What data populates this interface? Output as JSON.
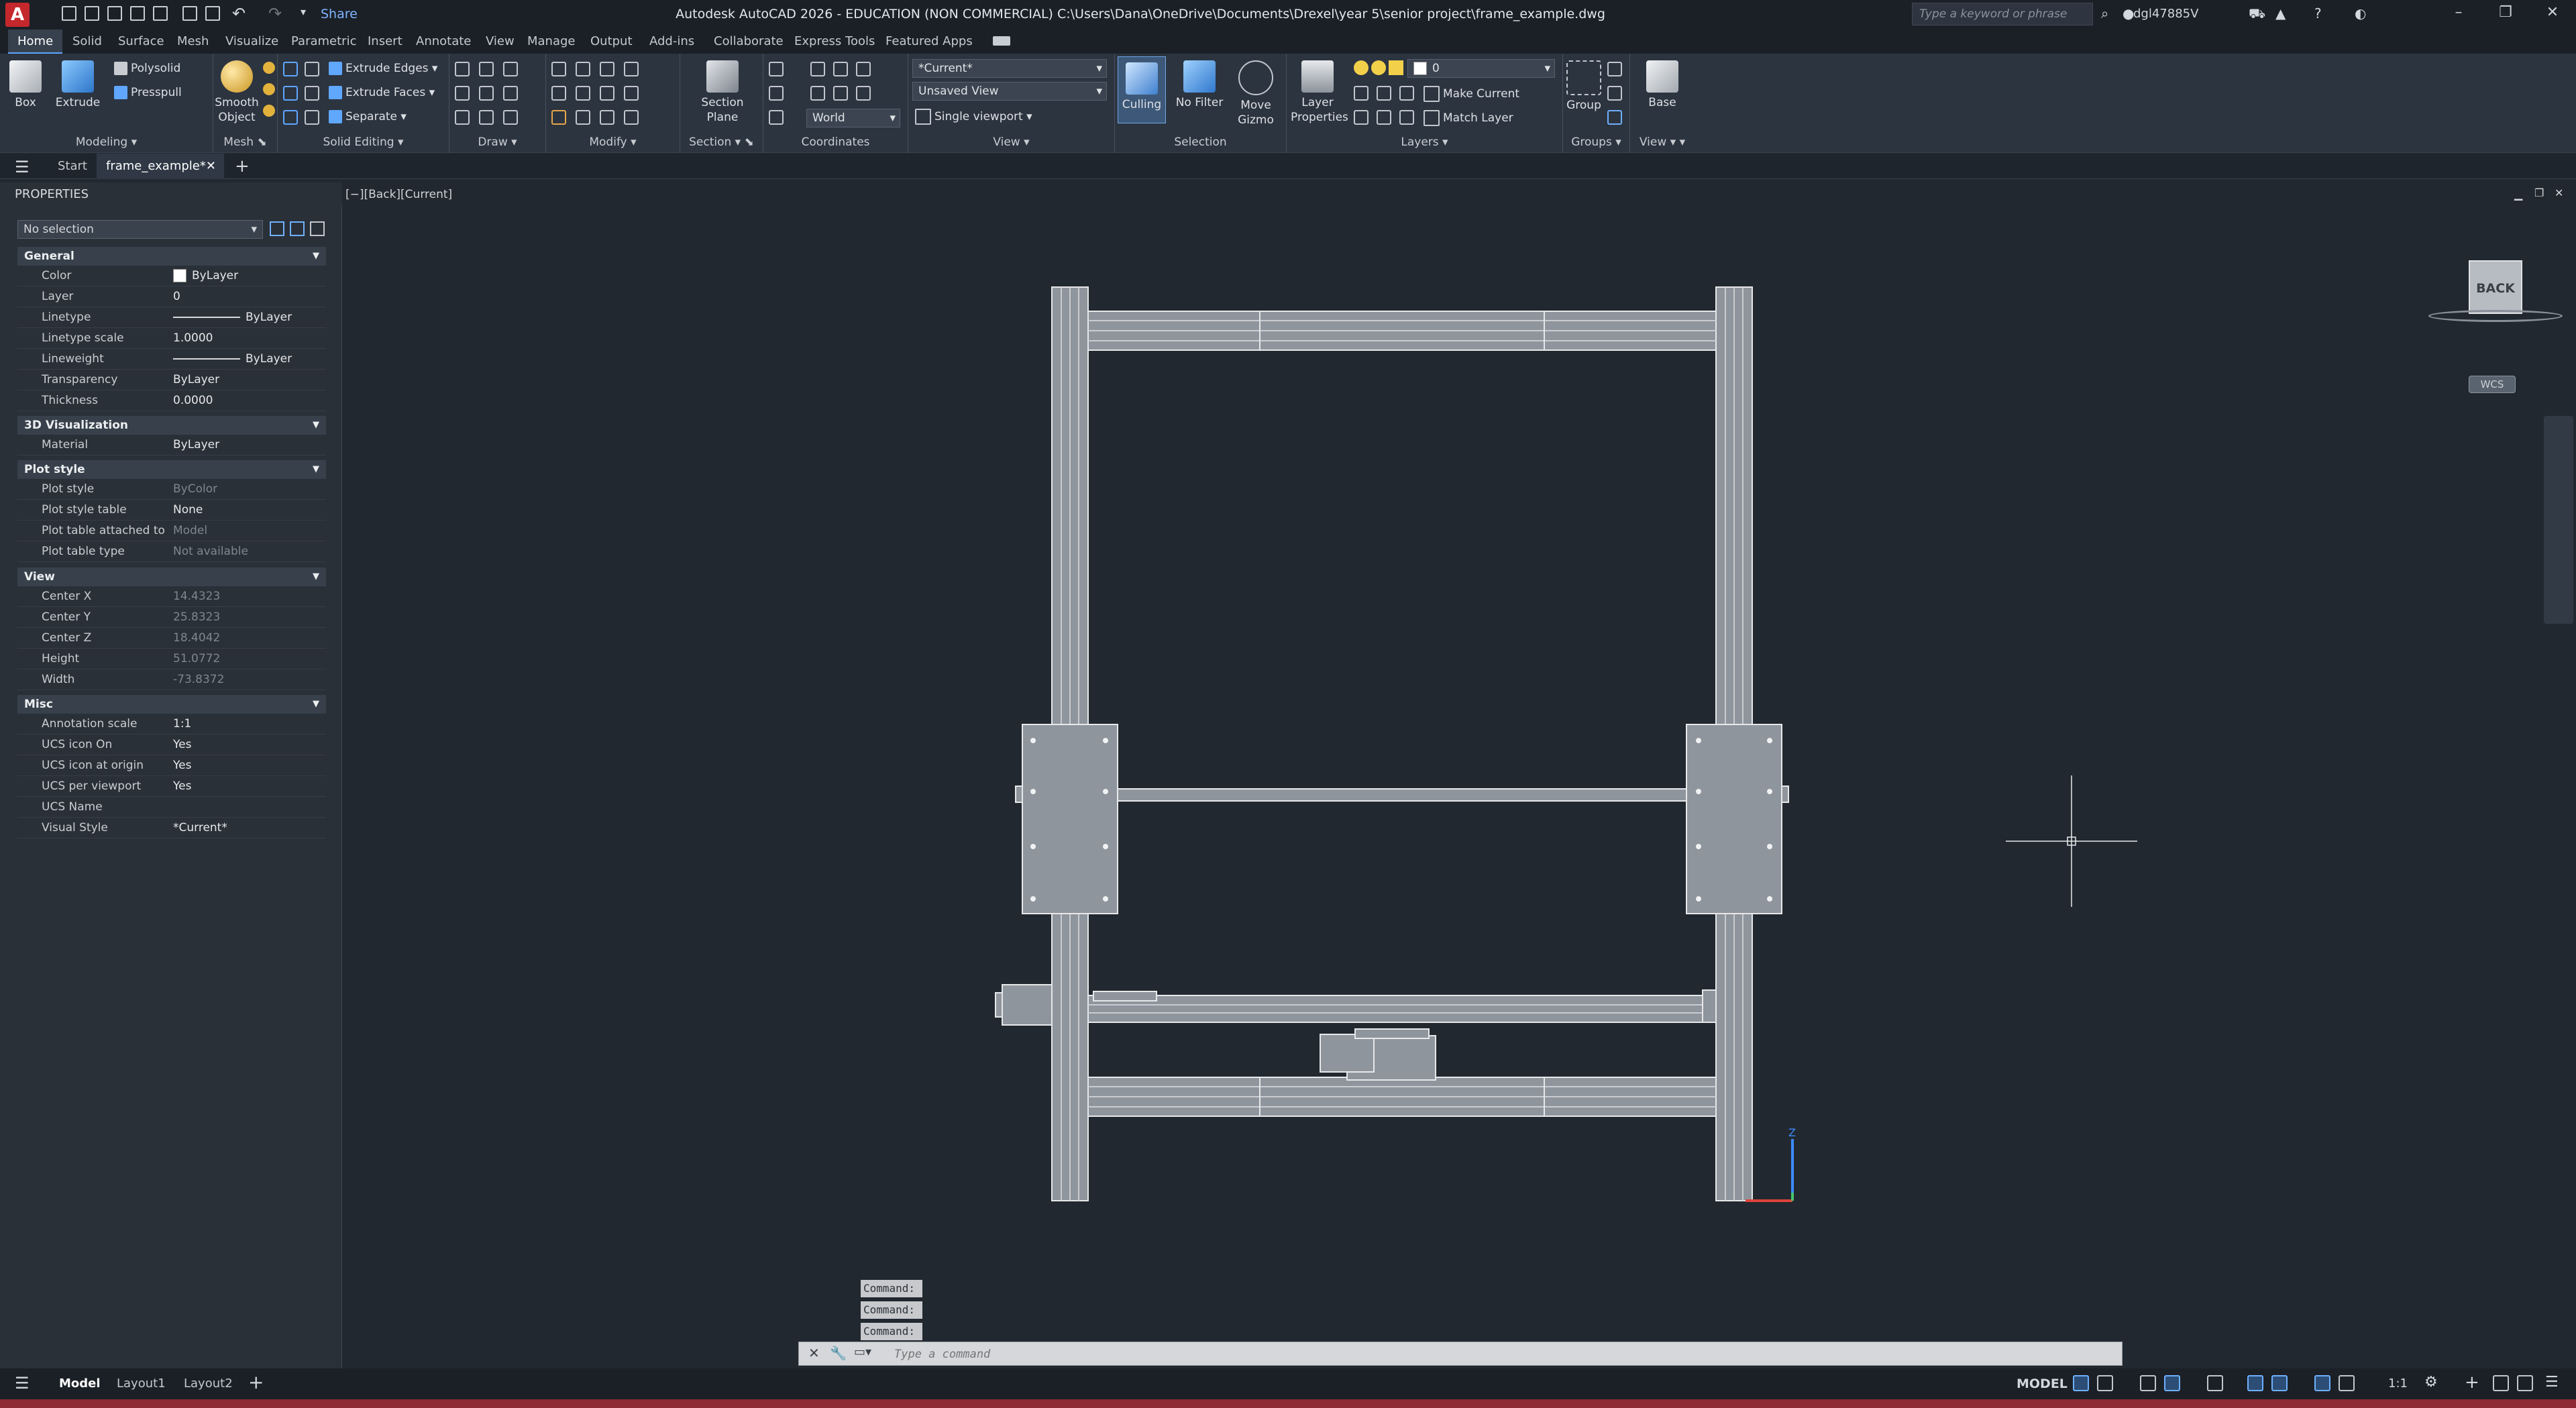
{
  "titlebar": {
    "logo": "A",
    "share": "Share",
    "title": "Autodesk AutoCAD 2026 - EDUCATION (NON COMMERCIAL)    C:\\Users\\Dana\\OneDrive\\Documents\\Drexel\\year 5\\senior project\\frame_example.dwg",
    "search_placeholder": "Type a keyword or phrase",
    "user": "dgl47885V"
  },
  "ribbon_tabs": [
    "Home",
    "Solid",
    "Surface",
    "Mesh",
    "Visualize",
    "Parametric",
    "Insert",
    "Annotate",
    "View",
    "Manage",
    "Output",
    "Add-ins",
    "Collaborate",
    "Express Tools",
    "Featured Apps"
  ],
  "ribbon": {
    "modeling": {
      "title": "Modeling",
      "box": "Box",
      "extrude": "Extrude",
      "polysolid": "Polysolid",
      "presspull": "Presspull"
    },
    "mesh": {
      "title": "Mesh",
      "smooth": "Smooth Object"
    },
    "solid_editing": {
      "title": "Solid Editing",
      "extrude_edges": "Extrude Edges",
      "extrude_faces": "Extrude Faces",
      "separate": "Separate"
    },
    "draw": {
      "title": "Draw"
    },
    "modify": {
      "title": "Modify"
    },
    "section": {
      "title": "Section",
      "plane": "Section Plane"
    },
    "coordinates": {
      "title": "Coordinates",
      "world": "World"
    },
    "view": {
      "title": "View",
      "visual_style": "*Current*",
      "named_view": "Unsaved View",
      "viewport": "Single viewport"
    },
    "selection": {
      "title": "Selection",
      "culling": "Culling",
      "no_filter": "No Filter",
      "move_gizmo": "Move Gizmo"
    },
    "layers": {
      "title": "Layers",
      "layer_props": "Layer Properties",
      "layer_value": "0",
      "make_current": "Make Current",
      "match_layer": "Match Layer"
    },
    "groups": {
      "title": "Groups",
      "group": "Group"
    },
    "view2": {
      "title": "View",
      "base": "Base"
    }
  },
  "file_tabs": {
    "start": "Start",
    "file": "frame_example*"
  },
  "properties": {
    "title": "PROPERTIES",
    "selection": "No selection",
    "sections": [
      {
        "name": "General",
        "rows": [
          {
            "k": "Color",
            "v": "ByLayer"
          },
          {
            "k": "Layer",
            "v": "0"
          },
          {
            "k": "Linetype",
            "v": "ByLayer"
          },
          {
            "k": "Linetype scale",
            "v": "1.0000"
          },
          {
            "k": "Lineweight",
            "v": "ByLayer"
          },
          {
            "k": "Transparency",
            "v": "ByLayer"
          },
          {
            "k": "Thickness",
            "v": "0.0000"
          }
        ]
      },
      {
        "name": "3D Visualization",
        "rows": [
          {
            "k": "Material",
            "v": "ByLayer"
          }
        ]
      },
      {
        "name": "Plot style",
        "rows": [
          {
            "k": "Plot style",
            "v": "ByColor"
          },
          {
            "k": "Plot style table",
            "v": "None"
          },
          {
            "k": "Plot table attached to",
            "v": "Model"
          },
          {
            "k": "Plot table type",
            "v": "Not available"
          }
        ]
      },
      {
        "name": "View",
        "rows": [
          {
            "k": "Center X",
            "v": "14.4323"
          },
          {
            "k": "Center Y",
            "v": "25.8323"
          },
          {
            "k": "Center Z",
            "v": "18.4042"
          },
          {
            "k": "Height",
            "v": "51.0772"
          },
          {
            "k": "Width",
            "v": "-73.8372"
          }
        ]
      },
      {
        "name": "Misc",
        "rows": [
          {
            "k": "Annotation scale",
            "v": "1:1"
          },
          {
            "k": "UCS icon On",
            "v": "Yes"
          },
          {
            "k": "UCS icon at origin",
            "v": "Yes"
          },
          {
            "k": "UCS per viewport",
            "v": "Yes"
          },
          {
            "k": "UCS Name",
            "v": ""
          },
          {
            "k": "Visual Style",
            "v": "*Current*"
          }
        ]
      }
    ]
  },
  "viewport": {
    "label": "[−][Back][Current]",
    "viewcube": "BACK",
    "wcs": "WCS"
  },
  "command": {
    "history": [
      "Command:",
      "Command:",
      "Command:"
    ],
    "placeholder": "Type a command"
  },
  "status": {
    "model_tab": "Model",
    "layout1": "Layout1",
    "layout2": "Layout2",
    "model_label": "MODEL",
    "scale": "1:1"
  }
}
